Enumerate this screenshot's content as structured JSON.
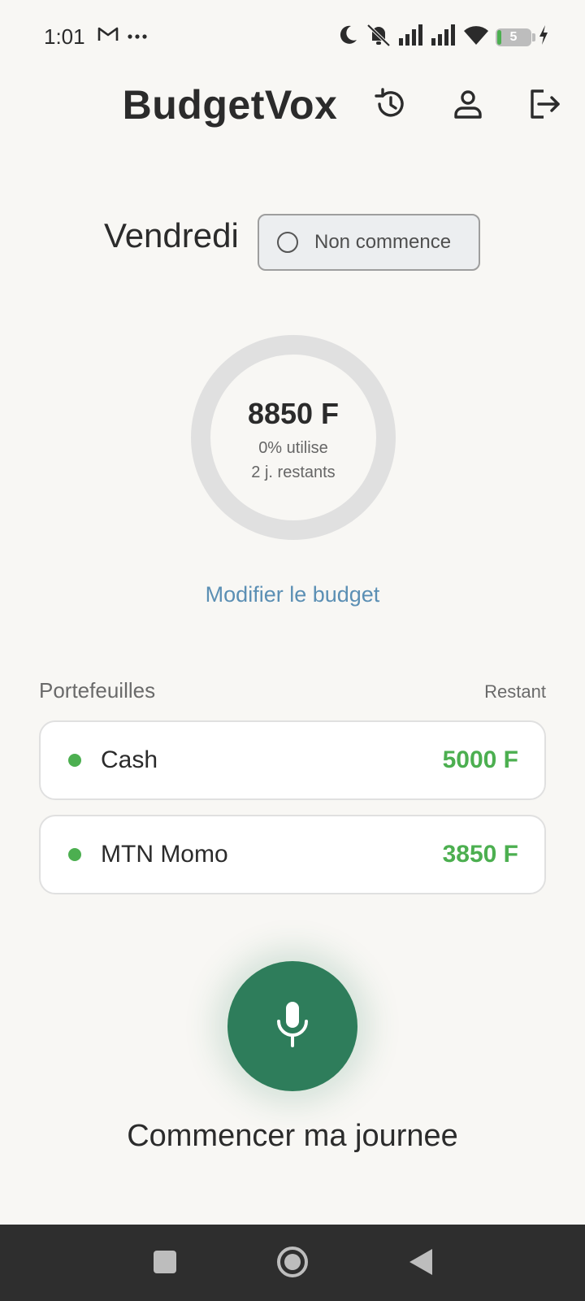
{
  "status_bar": {
    "time": "1:01",
    "left_icons": [
      "gmail-icon",
      "more-dots-icon"
    ],
    "right_icons": [
      "moon-icon",
      "bell-off-icon",
      "signal-icon",
      "signal-icon",
      "wifi-icon",
      "battery-icon",
      "charging-icon"
    ],
    "battery_level": "5"
  },
  "header": {
    "title": "BudgetVox",
    "icons": [
      "history-icon",
      "profile-icon",
      "logout-icon"
    ]
  },
  "day": {
    "label": "Vendredi",
    "status_label": "Non commence"
  },
  "budget": {
    "amount": "8850 F",
    "used": "0% utilise",
    "days_left": "2 j. restants",
    "used_fraction": 0,
    "modify_link": "Modifier le budget"
  },
  "wallets": {
    "title": "Portefeuilles",
    "remaining_label": "Restant",
    "items": [
      {
        "name": "Cash",
        "amount": "5000 F"
      },
      {
        "name": "MTN Momo",
        "amount": "3850 F"
      }
    ]
  },
  "action": {
    "icon": "microphone-icon",
    "label": "Commencer ma journee"
  },
  "colors": {
    "primary": "#2e7d5b",
    "accent_green": "#4caf50",
    "link": "#5b8fb4",
    "background": "#f8f7f4"
  },
  "nav_bar": {
    "icons": [
      "recents-icon",
      "home-icon",
      "back-icon"
    ]
  }
}
